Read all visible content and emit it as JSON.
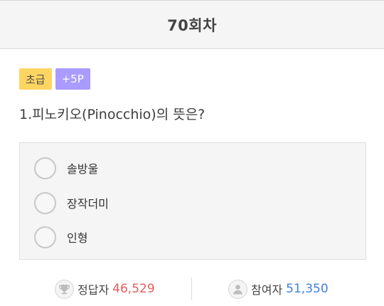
{
  "header": {
    "title": "70회차"
  },
  "badges": {
    "level": "초급",
    "points": "+5P"
  },
  "question": {
    "text": "1.피노키오(Pinocchio)의 뜻은?"
  },
  "options": [
    {
      "label": "솔방울",
      "selected": false
    },
    {
      "label": "장작더미",
      "selected": false
    },
    {
      "label": "인형",
      "selected": false
    }
  ],
  "stats": {
    "correct": {
      "label": "정답자",
      "value": "46,529",
      "icon": "trophy-icon"
    },
    "participants": {
      "label": "참여자",
      "value": "51,350",
      "icon": "person-icon"
    }
  },
  "colors": {
    "level_badge": "#ffd561",
    "points_badge": "#a99bff",
    "correct_value": "#e85b5b",
    "participants_value": "#3d80e0"
  }
}
